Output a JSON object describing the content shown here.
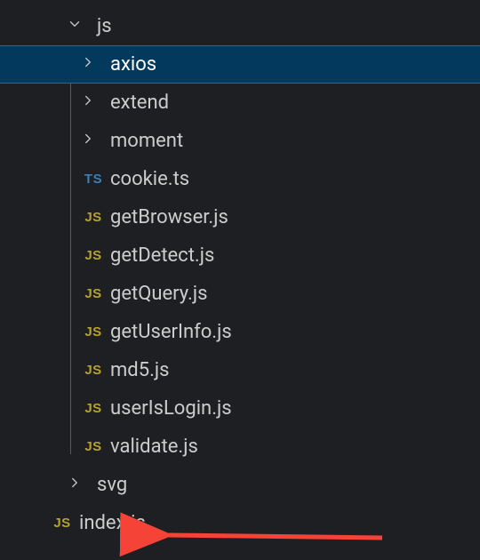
{
  "colors": {
    "background": "#1e1f22",
    "selectedBg": "#04395e",
    "selectedBorder": "#0a6fbf",
    "text": "#cccccc",
    "selectedText": "#ffffff",
    "tsIcon": "#3a7fb5",
    "jsIcon": "#b7a12f",
    "indentGuide": "#585858",
    "arrow": "#f54338"
  },
  "icons": {
    "js_badge": "JS",
    "ts_badge": "TS"
  },
  "tree": {
    "folder_js": {
      "name": "js",
      "expanded": true
    },
    "children": {
      "axios": {
        "name": "axios",
        "type": "folder",
        "expanded": false,
        "selected": true
      },
      "extend": {
        "name": "extend",
        "type": "folder",
        "expanded": false
      },
      "moment": {
        "name": "moment",
        "type": "folder",
        "expanded": false
      },
      "cookie": {
        "name": "cookie.ts",
        "type": "file",
        "lang": "ts"
      },
      "getBrowser": {
        "name": "getBrowser.js",
        "type": "file",
        "lang": "js"
      },
      "getDetect": {
        "name": "getDetect.js",
        "type": "file",
        "lang": "js"
      },
      "getQuery": {
        "name": "getQuery.js",
        "type": "file",
        "lang": "js"
      },
      "getUserInfo": {
        "name": "getUserInfo.js",
        "type": "file",
        "lang": "js"
      },
      "md5": {
        "name": "md5.js",
        "type": "file",
        "lang": "js"
      },
      "userIsLogin": {
        "name": "userIsLogin.js",
        "type": "file",
        "lang": "js"
      },
      "validate": {
        "name": "validate.js",
        "type": "file",
        "lang": "js"
      }
    },
    "folder_svg": {
      "name": "svg",
      "expanded": false
    },
    "index": {
      "name": "index.js",
      "type": "file",
      "lang": "js"
    }
  }
}
